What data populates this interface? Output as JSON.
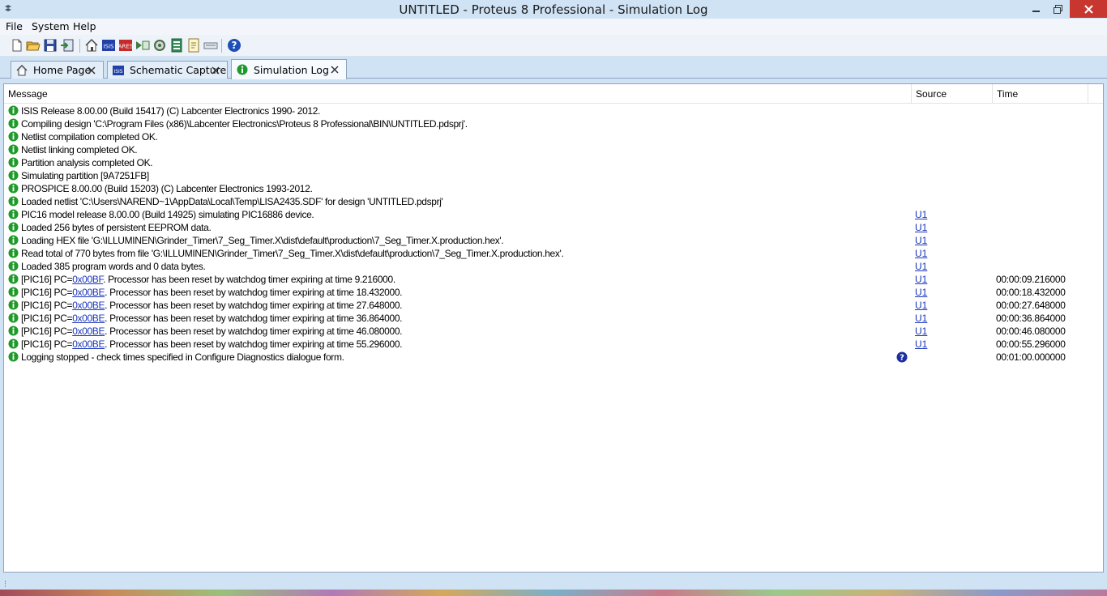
{
  "window": {
    "title": "UNTITLED - Proteus 8 Professional - Simulation Log"
  },
  "menu": {
    "items": [
      "File",
      "System",
      "Help"
    ]
  },
  "toolbar": {
    "icons": [
      "new-file-icon",
      "open-folder-icon",
      "save-icon",
      "import-icon",
      "home-icon",
      "schematic-icon",
      "pcb-icon",
      "design-explorer-icon",
      "gerber-icon",
      "bom-icon",
      "source-code-icon",
      "notes-icon",
      "help-icon"
    ]
  },
  "tabs": [
    {
      "label": "Home Page",
      "icon": "home-icon"
    },
    {
      "label": "Schematic Capture",
      "icon": "schematic-icon"
    },
    {
      "label": "Simulation Log",
      "icon": "info-icon",
      "active": true
    }
  ],
  "log": {
    "columns": {
      "message": "Message",
      "source": "Source",
      "time": "Time"
    },
    "rows": [
      {
        "message": "ISIS Release 8.00.00 (Build 15417) (C) Labcenter Electronics 1990- 2012.",
        "source": "",
        "time": ""
      },
      {
        "message": "Compiling design 'C:\\Program Files (x86)\\Labcenter Electronics\\Proteus 8 Professional\\BIN\\UNTITLED.pdsprj'.",
        "source": "",
        "time": ""
      },
      {
        "message": "Netlist compilation completed OK.",
        "source": "",
        "time": ""
      },
      {
        "message": "Netlist linking completed OK.",
        "source": "",
        "time": ""
      },
      {
        "message": "Partition analysis completed OK.",
        "source": "",
        "time": ""
      },
      {
        "message": "Simulating partition [9A7251FB]",
        "source": "",
        "time": ""
      },
      {
        "message": "PROSPICE 8.00.00 (Build 15203) (C) Labcenter Electronics 1993-2012.",
        "source": "",
        "time": ""
      },
      {
        "message": "Loaded netlist 'C:\\Users\\NAREND~1\\AppData\\Local\\Temp\\LISA2435.SDF' for design 'UNTITLED.pdsprj'",
        "source": "",
        "time": ""
      },
      {
        "message": "PIC16 model release 8.00.00 (Build 14925) simulating PIC16886 device.",
        "source": "U1",
        "time": ""
      },
      {
        "message": "Loaded 256 bytes of persistent EEPROM data.",
        "source": "U1",
        "time": ""
      },
      {
        "message": "Loading HEX file 'G:\\ILLUMINEN\\Grinder_Timer\\7_Seg_Timer.X\\dist\\default\\production\\7_Seg_Timer.X.production.hex'.",
        "source": "U1",
        "time": ""
      },
      {
        "message": "Read total of 770 bytes from file 'G:\\ILLUMINEN\\Grinder_Timer\\7_Seg_Timer.X\\dist\\default\\production\\7_Seg_Timer.X.production.hex'.",
        "source": "U1",
        "time": ""
      },
      {
        "message": "Loaded 385 program words and 0 data bytes.",
        "source": "U1",
        "time": ""
      },
      {
        "prefix": "[PIC16] PC=",
        "pc": "0x00BF",
        "message": ". Processor has been reset by watchdog timer expiring at time 9.216000.",
        "source": "U1",
        "time": "00:00:09.216000"
      },
      {
        "prefix": "[PIC16] PC=",
        "pc": "0x00BE",
        "message": ". Processor has been reset by watchdog timer expiring at time 18.432000.",
        "source": "U1",
        "time": "00:00:18.432000"
      },
      {
        "prefix": "[PIC16] PC=",
        "pc": "0x00BE",
        "message": ". Processor has been reset by watchdog timer expiring at time 27.648000.",
        "source": "U1",
        "time": "00:00:27.648000"
      },
      {
        "prefix": "[PIC16] PC=",
        "pc": "0x00BE",
        "message": ". Processor has been reset by watchdog timer expiring at time 36.864000.",
        "source": "U1",
        "time": "00:00:36.864000"
      },
      {
        "prefix": "[PIC16] PC=",
        "pc": "0x00BE",
        "message": ". Processor has been reset by watchdog timer expiring at time 46.080000.",
        "source": "U1",
        "time": "00:00:46.080000"
      },
      {
        "prefix": "[PIC16] PC=",
        "pc": "0x00BE",
        "message": ". Processor has been reset by watchdog timer expiring at time 55.296000.",
        "source": "U1",
        "time": "00:00:55.296000"
      },
      {
        "message": "Logging stopped - check times specified in Configure Diagnostics dialogue form.",
        "source": "",
        "time": "00:01:00.000000",
        "help": true
      }
    ]
  },
  "colors": {
    "info": "#1e9a28",
    "link": "#1a36b8",
    "chrome": "#cfe3f5",
    "close": "#c7372f"
  }
}
